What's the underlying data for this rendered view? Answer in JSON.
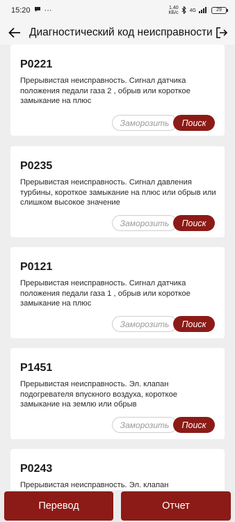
{
  "status_bar": {
    "time": "15:20",
    "extra": "···",
    "net_speed": "1,40 КБ/с",
    "signal": "4G",
    "battery": "29"
  },
  "app_bar": {
    "title": "Диагностический код неисправности"
  },
  "actions": {
    "freeze_label": "Заморозить",
    "search_label": "Поиск"
  },
  "codes": [
    {
      "code": "P0221",
      "description": "Прерывистая неисправность. Сигнал датчика положения педали газа 2 , обрыв или короткое замыкание на плюс"
    },
    {
      "code": "P0235",
      "description": "Прерывистая неисправность. Сигнал давления турбины, короткое замыкание на плюс или обрыв или слишком высокое значение"
    },
    {
      "code": "P0121",
      "description": "Прерывистая неисправность. Сигнал датчика положения педали газа 1 , обрыв или короткое замыкание на плюс"
    },
    {
      "code": "P1451",
      "description": "Прерывистая неисправность. Эл. клапан подогревателя впускного воздуха, короткое замыкание на землю или обрыв"
    },
    {
      "code": "P0243",
      "description": "Прерывистая неисправность. Эл. клапан"
    }
  ],
  "bottom": {
    "translate_label": "Перевод",
    "report_label": "Отчет"
  }
}
